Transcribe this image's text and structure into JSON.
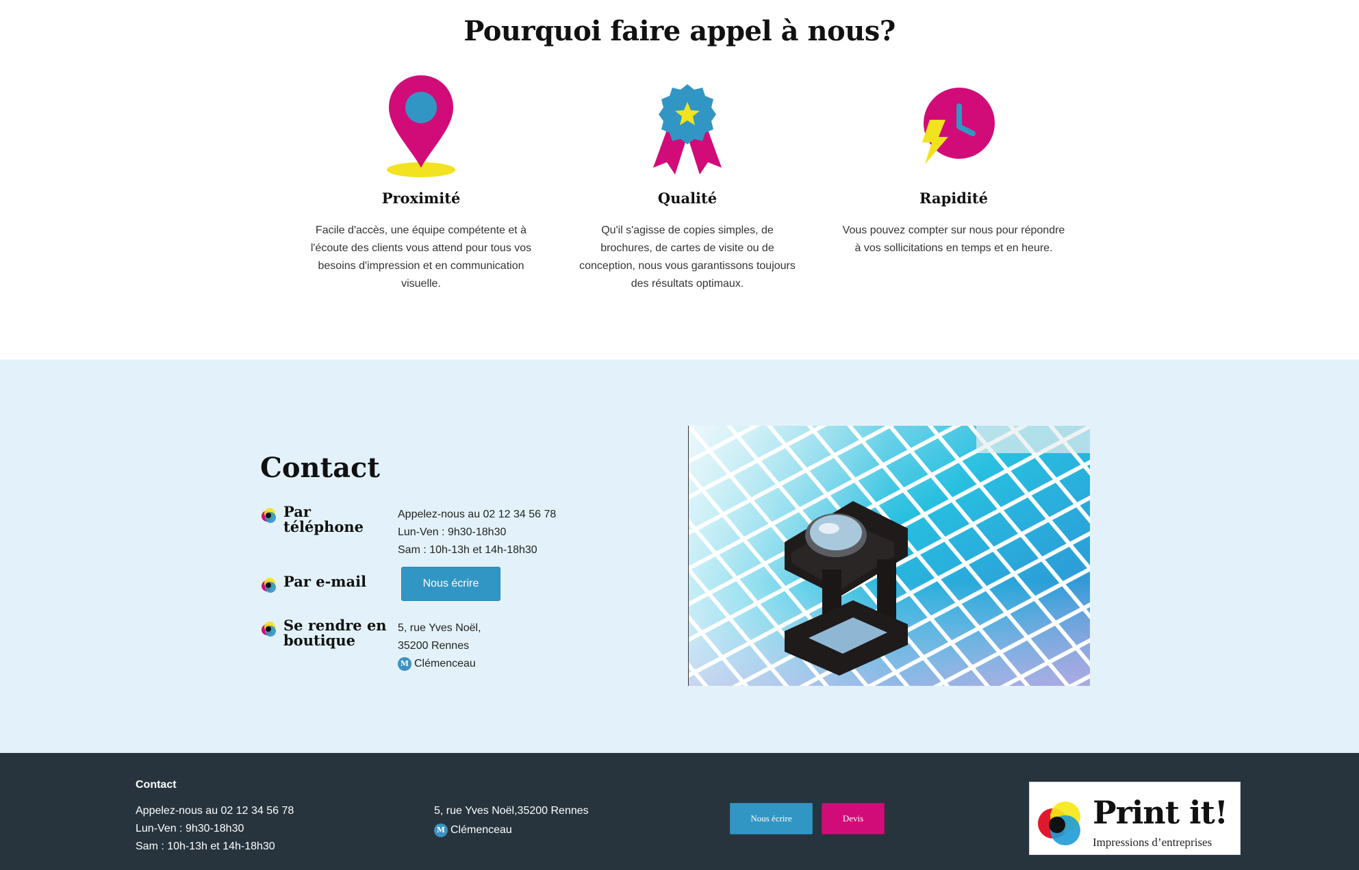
{
  "why": {
    "title": "Pourquoi faire appel à nous?",
    "features": [
      {
        "icon": "location-pin-icon",
        "title": "Proximité",
        "text": "Facile d'accès, une équipe compétente et à l'écoute des clients vous attend pour tous vos besoins d'impression et en communication visuelle."
      },
      {
        "icon": "award-ribbon-icon",
        "title": "Qualité",
        "text": "Qu'il s'agisse de copies simples, de brochures, de cartes de visite ou de conception, nous vous garantissons toujours des résultats optimaux."
      },
      {
        "icon": "clock-lightning-icon",
        "title": "Rapidité",
        "text": "Vous pouvez compter sur nous pour répondre à vos sollicitations en temps et en heure."
      }
    ]
  },
  "contact": {
    "title": "Contact",
    "phone": {
      "label": "Par téléphone",
      "line1": "Appelez-nous au 02 12 34 56 78",
      "line2": "Lun-Ven : 9h30-18h30",
      "line3": "Sam : 10h-13h et 14h-18h30"
    },
    "email": {
      "label": "Par e-mail",
      "button": "Nous écrire"
    },
    "shop": {
      "label": "Se rendre en boutique",
      "line1": "5, rue Yves Noël,",
      "line2": "35200 Rennes",
      "metro_badge": "M",
      "metro": "Clémenceau"
    }
  },
  "footer": {
    "title": "Contact",
    "line1": "Appelez-nous au 02 12 34 56 78",
    "line2": "Lun-Ven : 9h30-18h30",
    "line3": "Sam : 10h-13h et 14h-18h30",
    "address": "5, rue Yves Noël,35200 Rennes",
    "metro_badge": "M",
    "metro": "Clémenceau",
    "write_button": "Nous écrire",
    "quote_button": "Devis",
    "logo_brand": "Print it!",
    "logo_tagline": "Impressions d’entreprises"
  },
  "colors": {
    "magenta": "#d10c78",
    "blue": "#3196c4",
    "yellow": "#f2e21f",
    "contact_bg": "#e3f2fa",
    "footer_bg": "#27343d"
  }
}
